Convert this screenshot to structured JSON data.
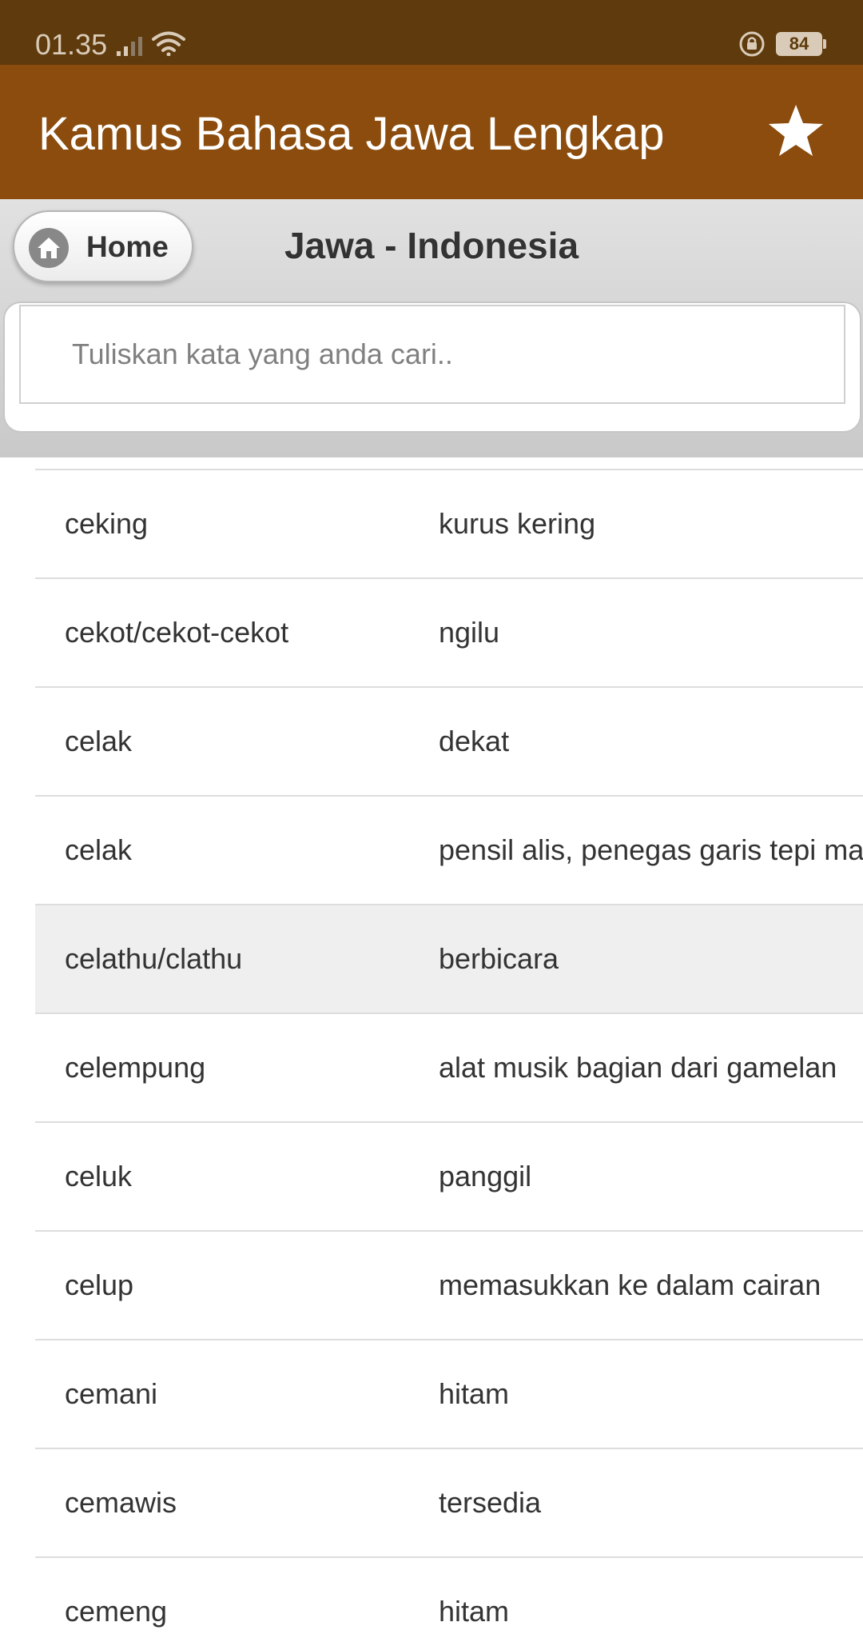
{
  "status_bar": {
    "time": "01.35",
    "battery": "84",
    "icons": [
      "signal-icon",
      "wifi-icon",
      "lock-rotation-icon",
      "battery-icon"
    ]
  },
  "app_bar": {
    "title": "Kamus Bahasa Jawa Lengkap",
    "icon": "star-icon",
    "background": "#8b4c0d"
  },
  "header": {
    "home_label": "Home",
    "home_icon": "home-icon",
    "title": "Jawa - Indonesia"
  },
  "search": {
    "placeholder": "Tuliskan kata yang anda cari..",
    "value": ""
  },
  "list": {
    "rows": [
      {
        "jawa": "ceking",
        "indonesia": "kurus kering"
      },
      {
        "jawa": "cekot/cekot-cekot",
        "indonesia": "ngilu"
      },
      {
        "jawa": "celak",
        "indonesia": "dekat"
      },
      {
        "jawa": "celak",
        "indonesia": "pensil alis, penegas garis tepi mat"
      },
      {
        "jawa": "celathu/clathu",
        "indonesia": "berbicara"
      },
      {
        "jawa": "celempung",
        "indonesia": "alat musik bagian dari gamelan"
      },
      {
        "jawa": "celuk",
        "indonesia": "panggil"
      },
      {
        "jawa": "celup",
        "indonesia": "memasukkan ke dalam cairan"
      },
      {
        "jawa": "cemani",
        "indonesia": "hitam"
      },
      {
        "jawa": "cemawis",
        "indonesia": "tersedia"
      },
      {
        "jawa": "cemeng",
        "indonesia": "hitam"
      }
    ]
  },
  "colors": {
    "status_bar": "#5e3a0c",
    "app_bar": "#8b4c0d",
    "highlight_row": "#efefef"
  }
}
